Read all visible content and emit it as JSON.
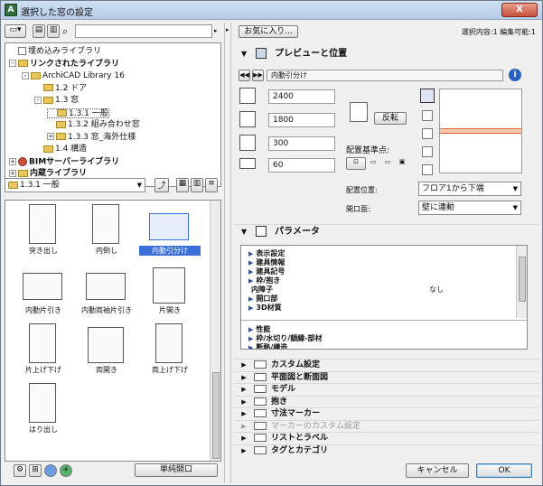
{
  "window": {
    "title": "選択した窓の設定",
    "close_glyph": "X"
  },
  "left": {
    "tree": [
      {
        "label": "埋め込みライブラリ",
        "indent": 0,
        "kind": "doc",
        "expander": "",
        "bold": false
      },
      {
        "label": "リンクされたライブラリ",
        "indent": 0,
        "kind": "folder",
        "expander": "-",
        "bold": true
      },
      {
        "label": "ArchiCAD Library 16",
        "indent": 1,
        "kind": "folder",
        "expander": "-",
        "bold": false
      },
      {
        "label": "1.2 ドア",
        "indent": 2,
        "kind": "folder",
        "expander": "",
        "bold": false
      },
      {
        "label": "1.3 窓",
        "indent": 2,
        "kind": "folder",
        "expander": "-",
        "bold": false
      },
      {
        "label": "1.3.1 一般",
        "indent": 3,
        "kind": "folder",
        "expander": "",
        "bold": false,
        "selected": true
      },
      {
        "label": "1.3.2 組み合わせ窓",
        "indent": 3,
        "kind": "folder",
        "expander": "",
        "bold": false
      },
      {
        "label": "1.3.3 窓_海外仕様",
        "indent": 3,
        "kind": "folder",
        "expander": "+",
        "bold": false
      },
      {
        "label": "1.4 構造",
        "indent": 2,
        "kind": "folder",
        "expander": "",
        "bold": false
      },
      {
        "label": "BIMサーバーライブラリ",
        "indent": 0,
        "kind": "globe",
        "expander": "+",
        "bold": true
      },
      {
        "label": "内蔵ライブラリ",
        "indent": 0,
        "kind": "folder",
        "expander": "+",
        "bold": true
      }
    ],
    "folder_dropdown": "1.3.1 一般",
    "items": [
      {
        "label": "突き出し",
        "variant": "tri",
        "selected": false
      },
      {
        "label": "内倒し",
        "variant": "tri-inv",
        "selected": false
      },
      {
        "label": "内動引分け",
        "variant": "triple",
        "selected": true
      },
      {
        "label": "内動片引き",
        "variant": "fix2",
        "selected": false
      },
      {
        "label": "内動両袖片引き",
        "variant": "fix3",
        "selected": false
      },
      {
        "label": "片開き",
        "variant": "diag",
        "selected": false
      },
      {
        "label": "片上げ下げ",
        "variant": "fixtop",
        "selected": false
      },
      {
        "label": "両開き",
        "variant": "double",
        "selected": false
      },
      {
        "label": "両上げ下げ",
        "variant": "updown",
        "selected": false
      },
      {
        "label": "はり出し",
        "variant": "bay",
        "selected": false
      }
    ],
    "single_open_button": "単純開口"
  },
  "right": {
    "favorites_button": "お気に入り...",
    "selection_info": "選択内容:1 編集可能:1",
    "preview_header": "プレビューと位置",
    "object_name": "内動引分け",
    "dims": {
      "width": "2400",
      "height": "1800",
      "sill": "300",
      "depth": "60"
    },
    "mirror_button": "反転",
    "anchor_label": "配置基準点:",
    "placement_label": "配置位置:",
    "placement_value": "フロア1から下端",
    "opening_label": "開口面:",
    "opening_value": "壁に連動",
    "params_header": "パラメータ",
    "params": [
      {
        "label": "表示設定",
        "value": "",
        "arrow": true
      },
      {
        "label": "建具情報",
        "value": "",
        "arrow": true
      },
      {
        "label": "建具記号",
        "value": "",
        "arrow": true
      },
      {
        "label": "枠/抱き",
        "value": "",
        "arrow": true
      },
      {
        "label": "内障子",
        "value": "なし",
        "arrow": false
      },
      {
        "label": "開口部",
        "value": "",
        "arrow": true
      },
      {
        "label": "3D材質",
        "value": "",
        "arrow": true
      },
      {
        "label": "性能",
        "value": "",
        "arrow": true
      },
      {
        "label": "枠/水切り/額縁-部材",
        "value": "",
        "arrow": true
      },
      {
        "label": "断熱/構造",
        "value": "",
        "arrow": true
      }
    ],
    "sections": [
      {
        "label": "カスタム設定",
        "disabled": false
      },
      {
        "label": "平面図と断面図",
        "disabled": false
      },
      {
        "label": "モデル",
        "disabled": false
      },
      {
        "label": "抱き",
        "disabled": false
      },
      {
        "label": "寸法マーカー",
        "disabled": false
      },
      {
        "label": "マーカーのカスタム設定",
        "disabled": true
      },
      {
        "label": "リストとラベル",
        "disabled": false
      },
      {
        "label": "タグとカテゴリ",
        "disabled": false
      }
    ],
    "cancel_button": "キャンセル",
    "ok_button": "OK"
  },
  "colors": {
    "selection": "#3a6fd8",
    "accent_orange": "#e0662a",
    "folder": "#e9c55a"
  }
}
